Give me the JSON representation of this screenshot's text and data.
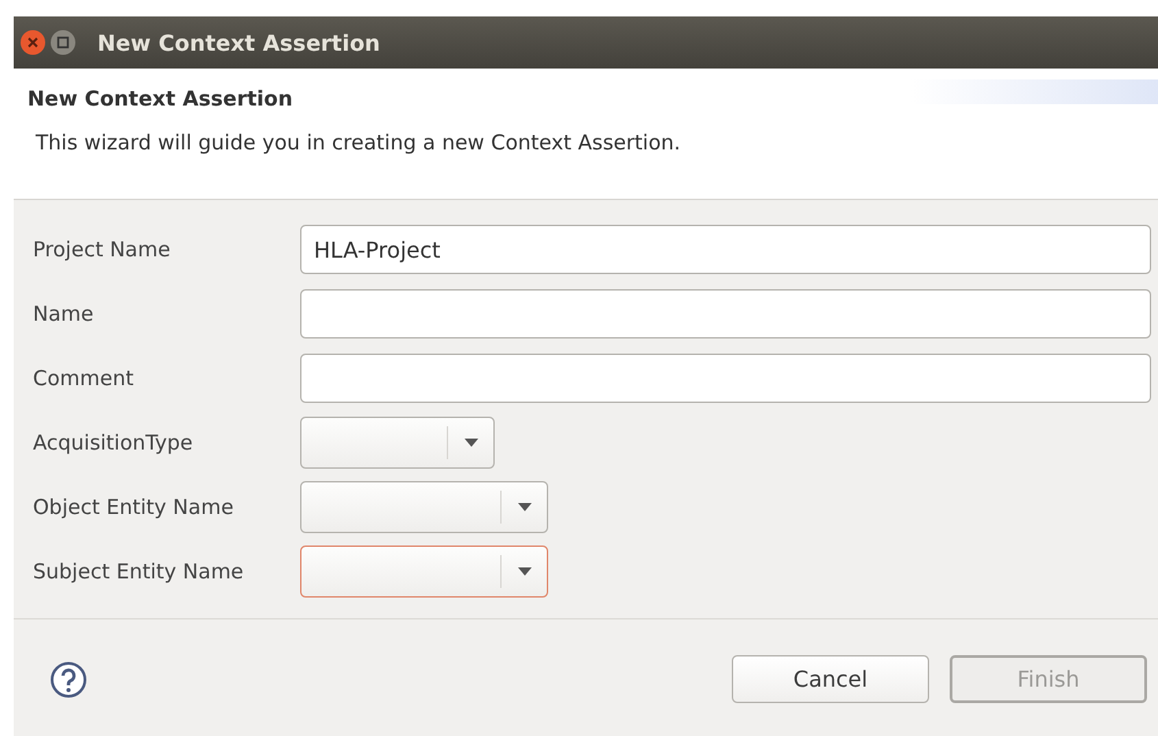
{
  "window": {
    "title": "New Context Assertion"
  },
  "header": {
    "title": "New Context Assertion",
    "description": "This wizard will guide you in creating a new Context Assertion."
  },
  "fields": [
    {
      "label": "Project Name",
      "kind": "text",
      "value": "HLA-Project",
      "invalid": false
    },
    {
      "label": "Name",
      "kind": "text",
      "invalid": false
    },
    {
      "label": "Comment",
      "kind": "text",
      "invalid": false
    },
    {
      "label": "AcquisitionType",
      "kind": "combo",
      "invalid": false
    },
    {
      "label": "Object Entity Name",
      "kind": "combo",
      "invalid": false
    },
    {
      "label": "Subject Entity Name",
      "kind": "combo",
      "invalid": true
    }
  ],
  "buttons": [
    {
      "label": "Cancel",
      "disabled": false
    },
    {
      "label": "Finish",
      "disabled": true
    }
  ]
}
